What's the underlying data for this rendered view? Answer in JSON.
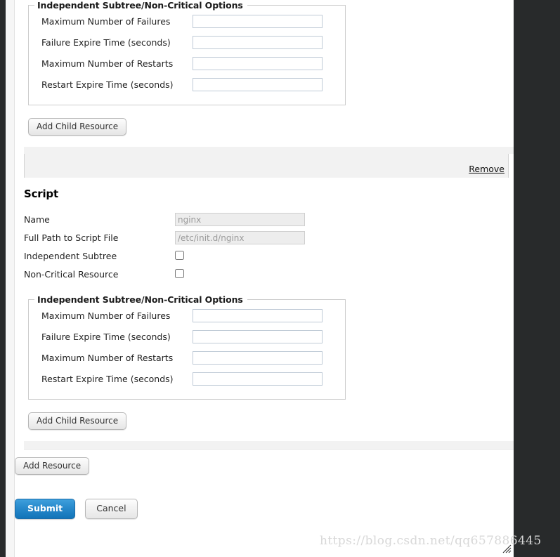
{
  "watermark": "https://blog.csdn.net/qq657886445",
  "options_legend": "Independent Subtree/Non-Critical Options",
  "option_fields": [
    {
      "label": "Maximum Number of Failures",
      "value": ""
    },
    {
      "label": "Failure Expire Time (seconds)",
      "value": ""
    },
    {
      "label": "Maximum Number of Restarts",
      "value": ""
    },
    {
      "label": "Restart Expire Time (seconds)",
      "value": ""
    }
  ],
  "buttons": {
    "add_child_resource": "Add Child Resource",
    "add_resource": "Add Resource",
    "submit": "Submit",
    "cancel": "Cancel"
  },
  "links": {
    "remove": "Remove"
  },
  "script_section": {
    "title": "Script",
    "fields": [
      {
        "label": "Name",
        "type": "text",
        "value": "nginx",
        "disabled": true
      },
      {
        "label": "Full Path to Script File",
        "type": "text",
        "value": "/etc/init.d/nginx",
        "disabled": true
      },
      {
        "label": "Independent Subtree",
        "type": "checkbox",
        "checked": false
      },
      {
        "label": "Non-Critical Resource",
        "type": "checkbox",
        "checked": false
      }
    ]
  },
  "colors": {
    "primary_button": "#1274b8",
    "page_chrome": "#282a2b",
    "band": "#f2f2f2",
    "input_border": "#bfcad6"
  }
}
